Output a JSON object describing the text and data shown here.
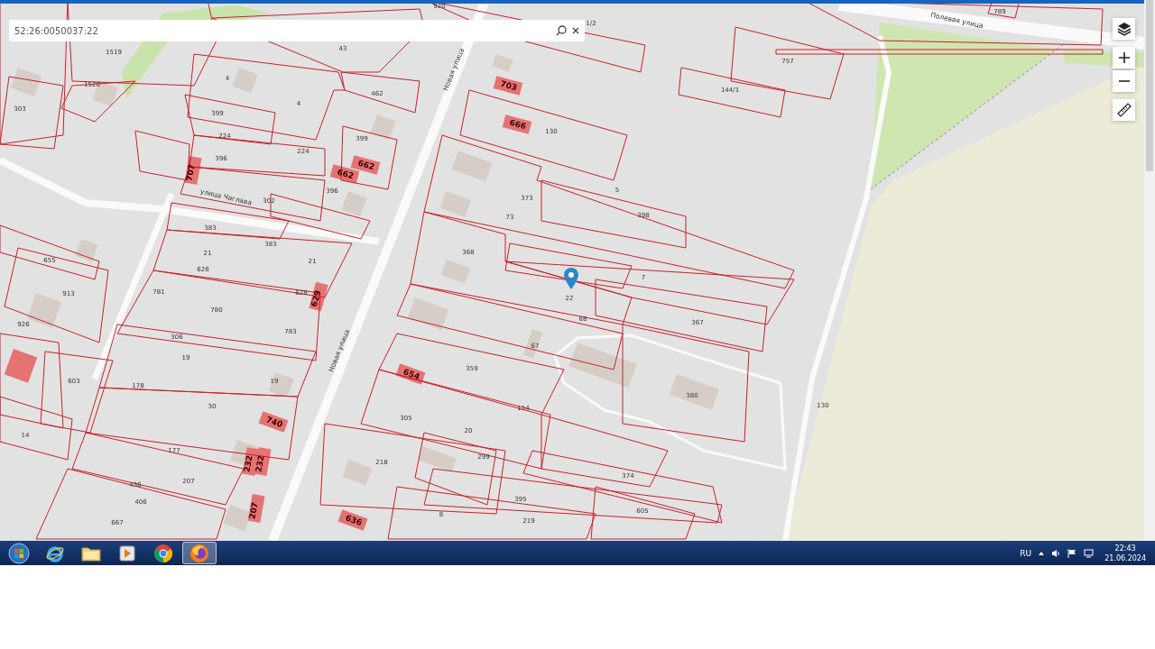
{
  "search": {
    "value": "52:26:0050037:22"
  },
  "map": {
    "parcel_labels": [
      "1519",
      "1520",
      "303",
      "43",
      "4",
      "4",
      "462",
      "399",
      "224",
      "224",
      "399",
      "396",
      "396",
      "302",
      "383",
      "383",
      "21",
      "21",
      "655",
      "628",
      "913",
      "781",
      "780",
      "628",
      "926",
      "783",
      "306",
      "19",
      "178",
      "603",
      "19",
      "30",
      "14",
      "177",
      "207",
      "436",
      "406",
      "667",
      "218",
      "920",
      "1/2",
      "130",
      "757",
      "144/1",
      "5",
      "373",
      "398",
      "73",
      "368",
      "7",
      "22",
      "68",
      "367",
      "67",
      "359",
      "380",
      "114",
      "305",
      "20",
      "299",
      "374",
      "395",
      "605",
      "8",
      "219",
      "130",
      "789"
    ],
    "building_labels": [
      "707",
      "662",
      "662",
      "703",
      "666",
      "629",
      "740",
      "232",
      "232",
      "207",
      "654",
      "636"
    ],
    "street_labels": [
      "Полевая улица",
      "Новая улица",
      "Новая улица",
      "улица Чаглава"
    ]
  },
  "taskbar": {
    "apps": [
      {
        "kind": "start",
        "selected": false
      },
      {
        "kind": "ie",
        "selected": false
      },
      {
        "kind": "folder",
        "selected": false
      },
      {
        "kind": "media",
        "selected": false
      },
      {
        "kind": "chrome",
        "selected": false
      },
      {
        "kind": "firefox",
        "selected": true
      }
    ],
    "language": "RU",
    "time": "22:43",
    "date": "21.06.2024"
  }
}
